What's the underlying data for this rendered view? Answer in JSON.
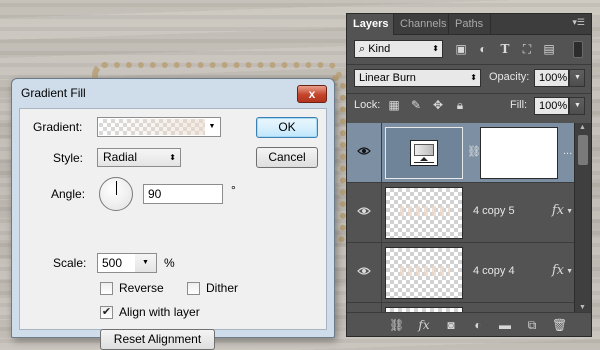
{
  "dialog": {
    "title": "Gradient Fill",
    "close_label": "x",
    "gradient_label": "Gradient:",
    "style_label": "Style:",
    "style_value": "Radial",
    "angle_label": "Angle:",
    "angle_value": "90",
    "angle_unit": "°",
    "scale_label": "Scale:",
    "scale_value": "500",
    "scale_unit": "%",
    "reverse_label": "Reverse",
    "reverse_checked": false,
    "dither_label": "Dither",
    "dither_checked": false,
    "align_label": "Align with layer",
    "align_checked": true,
    "ok_label": "OK",
    "cancel_label": "Cancel",
    "reset_label": "Reset Alignment"
  },
  "layers_panel": {
    "tabs": [
      "Layers",
      "Channels",
      "Paths"
    ],
    "active_tab": "Layers",
    "filter_kind": "Kind",
    "blend_mode": "Linear Burn",
    "opacity_label": "Opacity:",
    "opacity_value": "100%",
    "lock_label": "Lock:",
    "fill_label": "Fill:",
    "fill_value": "100%",
    "layers": [
      {
        "name": "",
        "type": "gradient-fill",
        "selected": true
      },
      {
        "name": "4 copy 5",
        "type": "pixel",
        "fx": "fx",
        "selected": false
      },
      {
        "name": "4 copy 4",
        "type": "pixel",
        "fx": "fx",
        "selected": false
      }
    ],
    "ellipsis": "..."
  },
  "icons": {
    "eye": "eye-icon",
    "link": "link-icon",
    "fx": "fx-icon"
  },
  "colors": {
    "panel_bg": "#535353",
    "selected_row": "#7c8fa3",
    "dialog_frame": "#cfdcea"
  }
}
